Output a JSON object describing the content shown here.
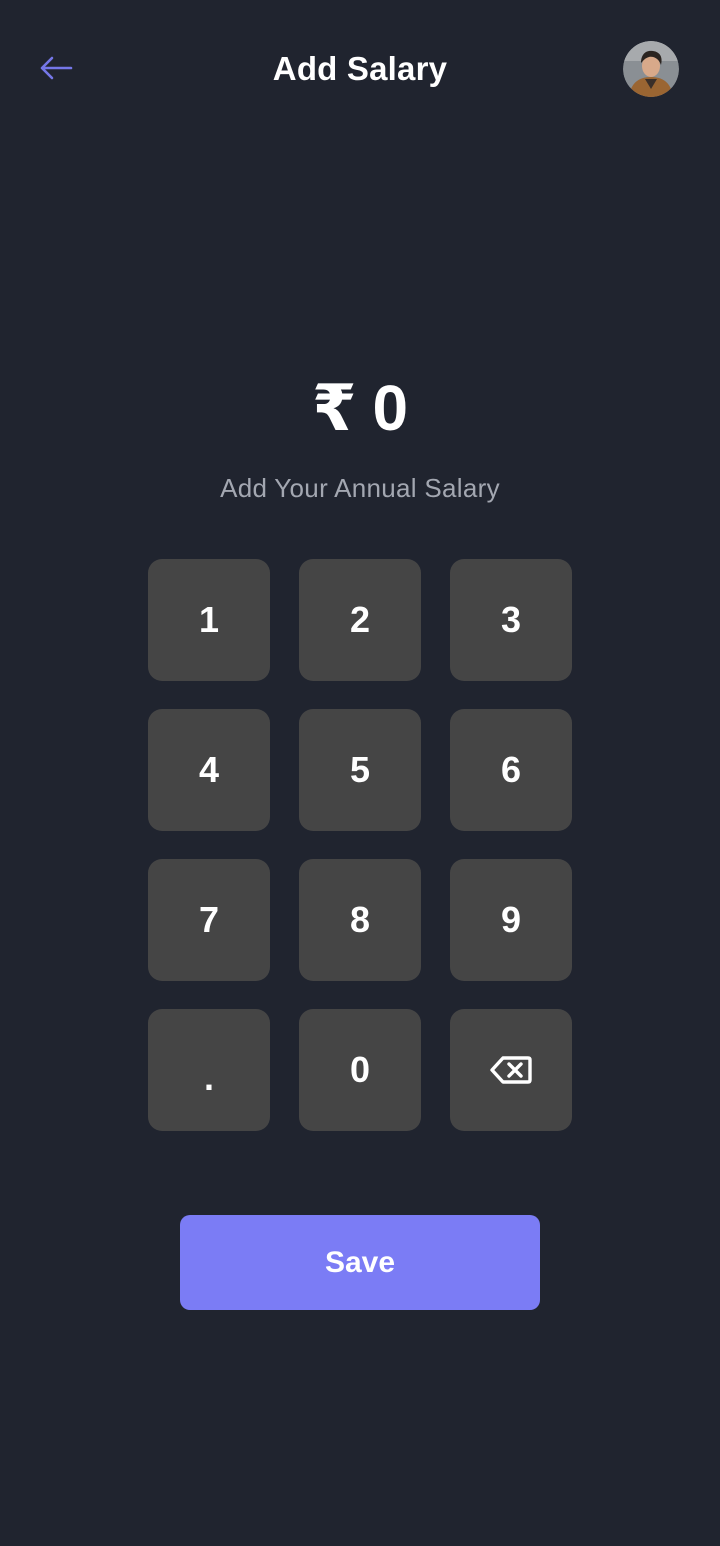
{
  "header": {
    "title": "Add Salary",
    "back_icon": "arrow-left-icon",
    "avatar_icon": "user-avatar"
  },
  "amount": {
    "currency_symbol": "₹",
    "value": "0"
  },
  "subtitle": "Add Your Annual Salary",
  "keypad": {
    "keys": [
      "1",
      "2",
      "3",
      "4",
      "5",
      "6",
      "7",
      "8",
      "9",
      ".",
      "0"
    ],
    "backspace_icon": "backspace-icon"
  },
  "save_button": {
    "label": "Save"
  },
  "colors": {
    "background": "#20242f",
    "key_background": "#454545",
    "accent": "#7b7cf5",
    "back_arrow": "#7577e8",
    "subtitle_text": "#a3a7b1"
  }
}
